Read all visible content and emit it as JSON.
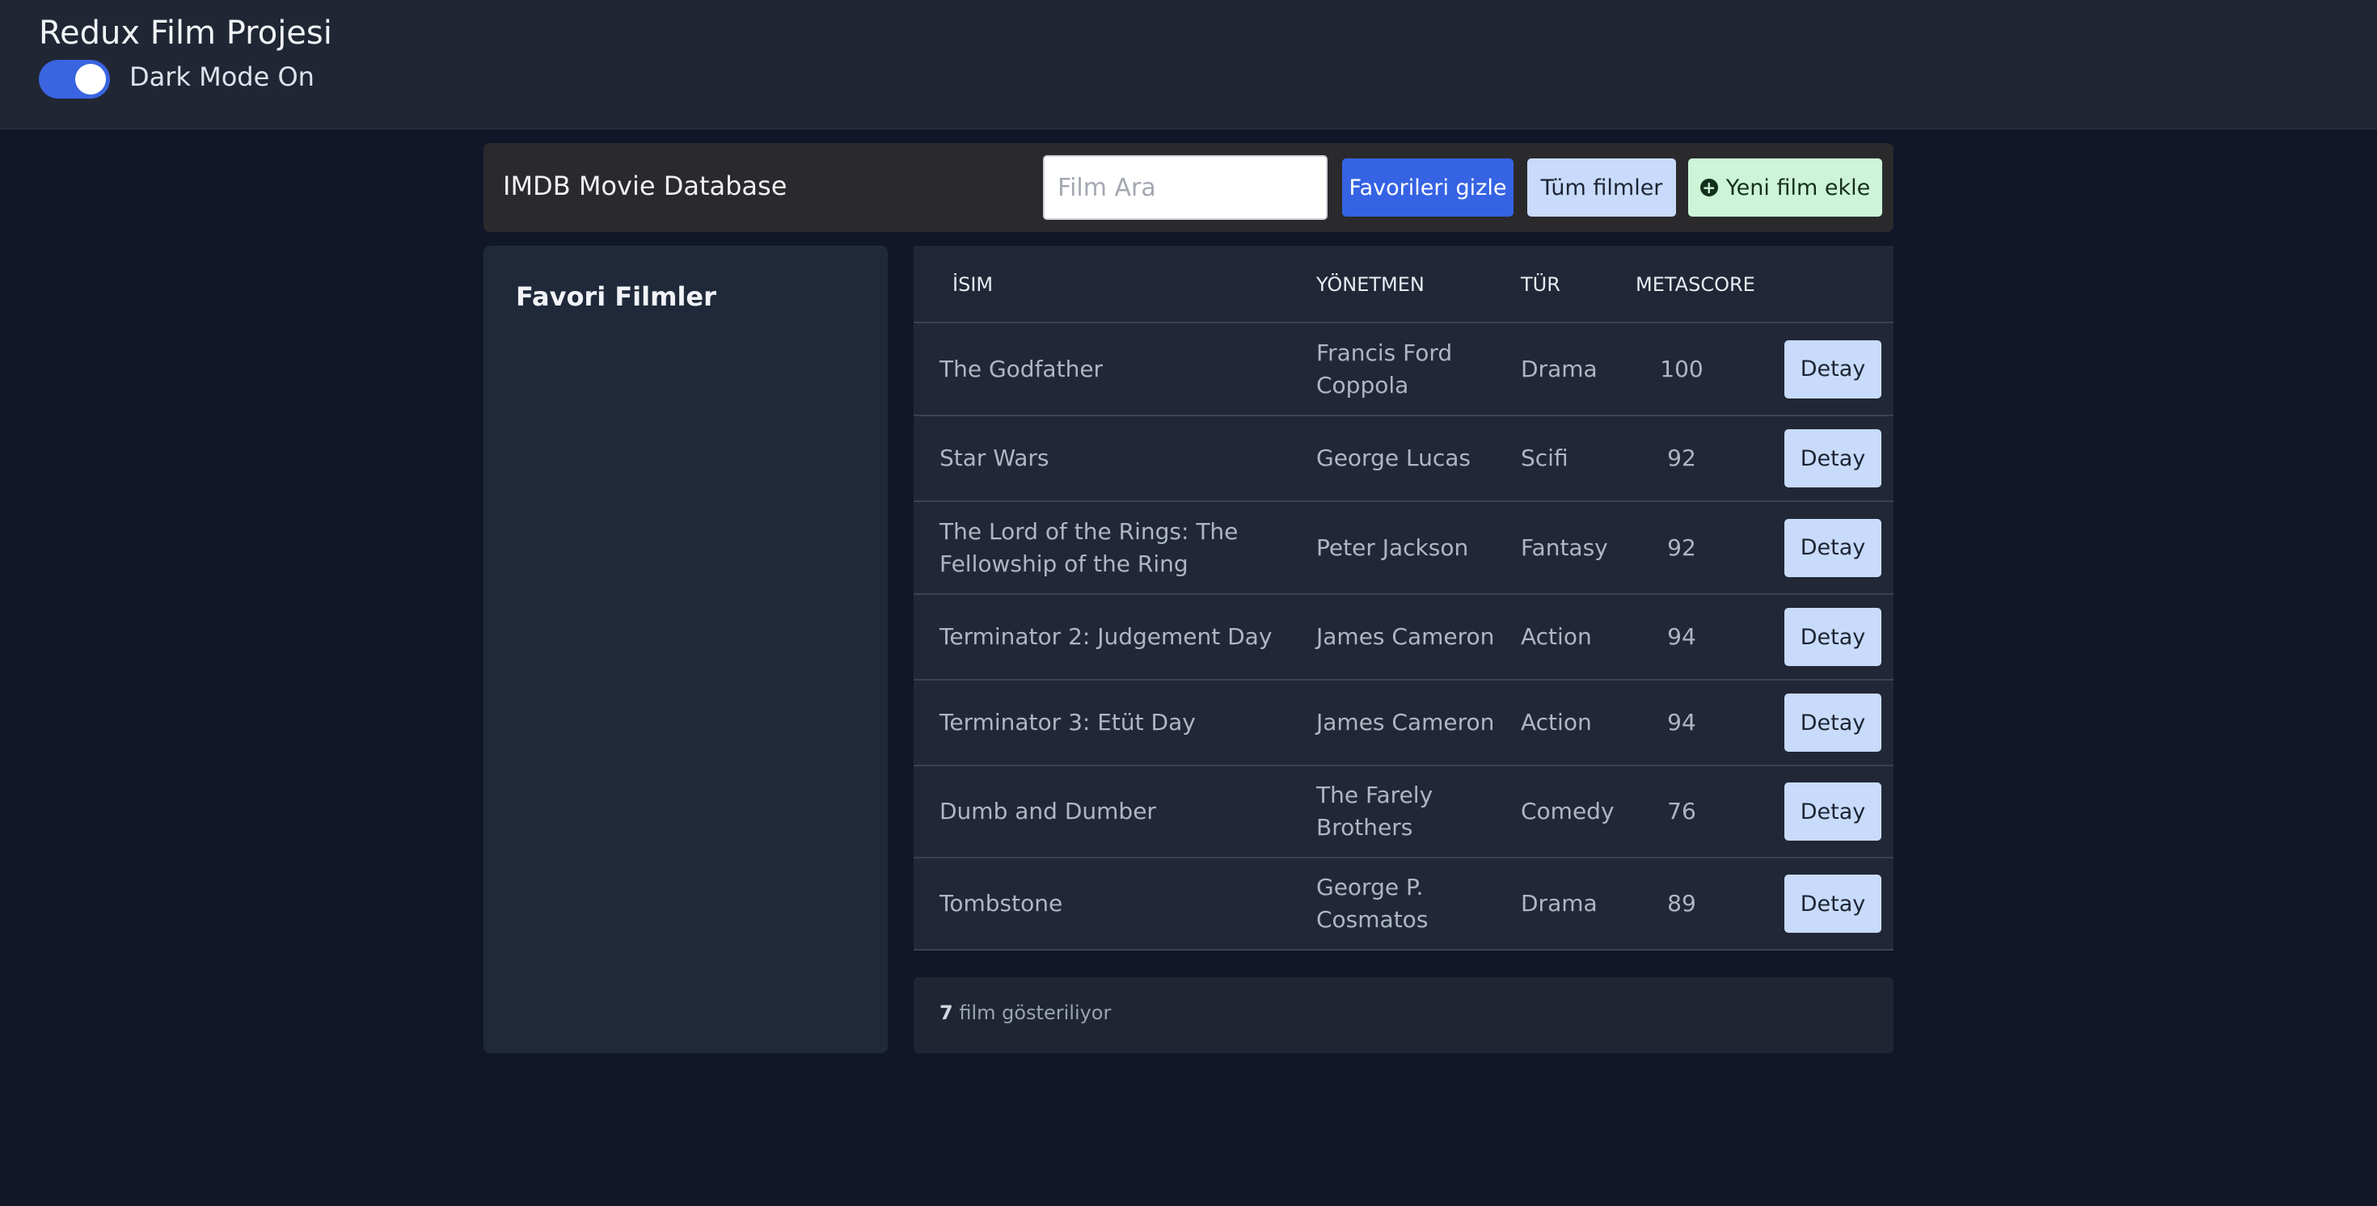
{
  "header": {
    "app_title": "Redux Film Projesi",
    "dark_mode_label": "Dark Mode On",
    "dark_mode_enabled": true
  },
  "navbar": {
    "title": "IMDB Movie Database",
    "search_placeholder": "Film Ara",
    "search_value": "",
    "hide_favorites_label": "Favorileri gizle",
    "all_movies_label": "Tüm filmler",
    "add_movie_label": "Yeni film ekle",
    "add_movie_icon": "plus-circle-icon"
  },
  "favorites": {
    "title": "Favori Filmler"
  },
  "table": {
    "headers": {
      "name": "İSIM",
      "director": "YÖNETMEN",
      "genre": "TÜR",
      "metascore": "METASCORE"
    },
    "detail_label": "Detay",
    "rows": [
      {
        "name": "The Godfather",
        "director": "Francis Ford Coppola",
        "genre": "Drama",
        "metascore": "100"
      },
      {
        "name": "Star Wars",
        "director": "George Lucas",
        "genre": "Scifi",
        "metascore": "92"
      },
      {
        "name": "The Lord of the Rings: The Fellowship of the Ring",
        "director": "Peter Jackson",
        "genre": "Fantasy",
        "metascore": "92"
      },
      {
        "name": "Terminator 2: Judgement Day",
        "director": "James Cameron",
        "genre": "Action",
        "metascore": "94"
      },
      {
        "name": "Terminator 3: Etüt Day",
        "director": "James Cameron",
        "genre": "Action",
        "metascore": "94"
      },
      {
        "name": "Dumb and Dumber",
        "director": "The Farely Brothers",
        "genre": "Comedy",
        "metascore": "76"
      },
      {
        "name": "Tombstone",
        "director": "George P. Cosmatos",
        "genre": "Drama",
        "metascore": "89"
      }
    ]
  },
  "footer": {
    "count": "7",
    "text": "film gösteriliyor"
  },
  "colors": {
    "page_bg": "#111729",
    "topbar_bg": "#202634",
    "toggle_on": "#3a64e0",
    "primary_button": "#3563e3",
    "light_button": "#c8dbfa",
    "success_button": "#cdf4d7"
  }
}
